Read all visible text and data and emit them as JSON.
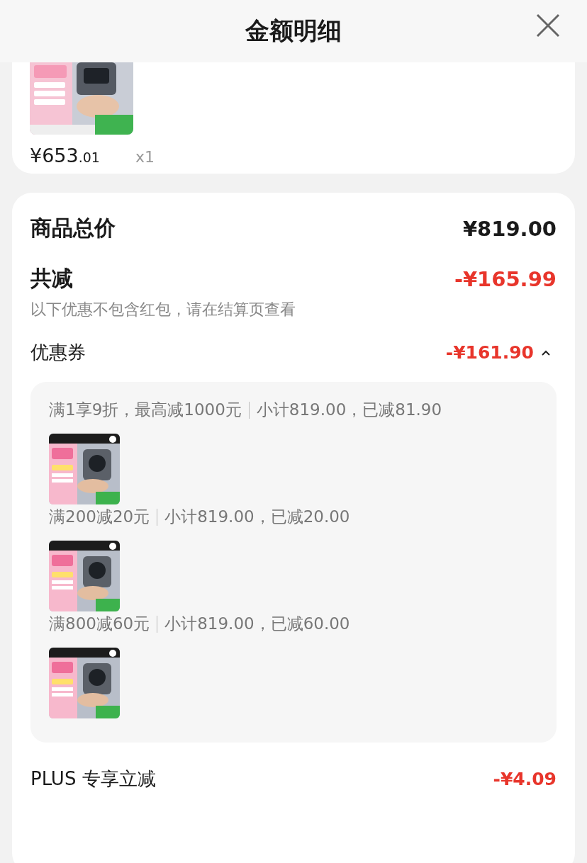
{
  "header": {
    "title": "金额明细"
  },
  "product": {
    "price_main": "¥653",
    "price_decimal": ".01",
    "quantity": "x1"
  },
  "summary": {
    "total_label": "商品总价",
    "total_value": "¥819.00",
    "discount_label": "共减",
    "discount_value": "-¥165.99",
    "discount_note": "以下优惠不包含红包，请在结算页查看"
  },
  "coupons": {
    "label": "优惠券",
    "value": "-¥161.90",
    "expanded": true,
    "items": [
      {
        "rule": "满1享9折，最高减1000元",
        "subtotal": "小计819.00，已减81.90"
      },
      {
        "rule": "满200减20元",
        "subtotal": "小计819.00，已减20.00"
      },
      {
        "rule": "满800减60元",
        "subtotal": "小计819.00，已减60.00"
      }
    ]
  },
  "plus": {
    "label": "PLUS 专享立减",
    "value": "-¥4.09"
  }
}
